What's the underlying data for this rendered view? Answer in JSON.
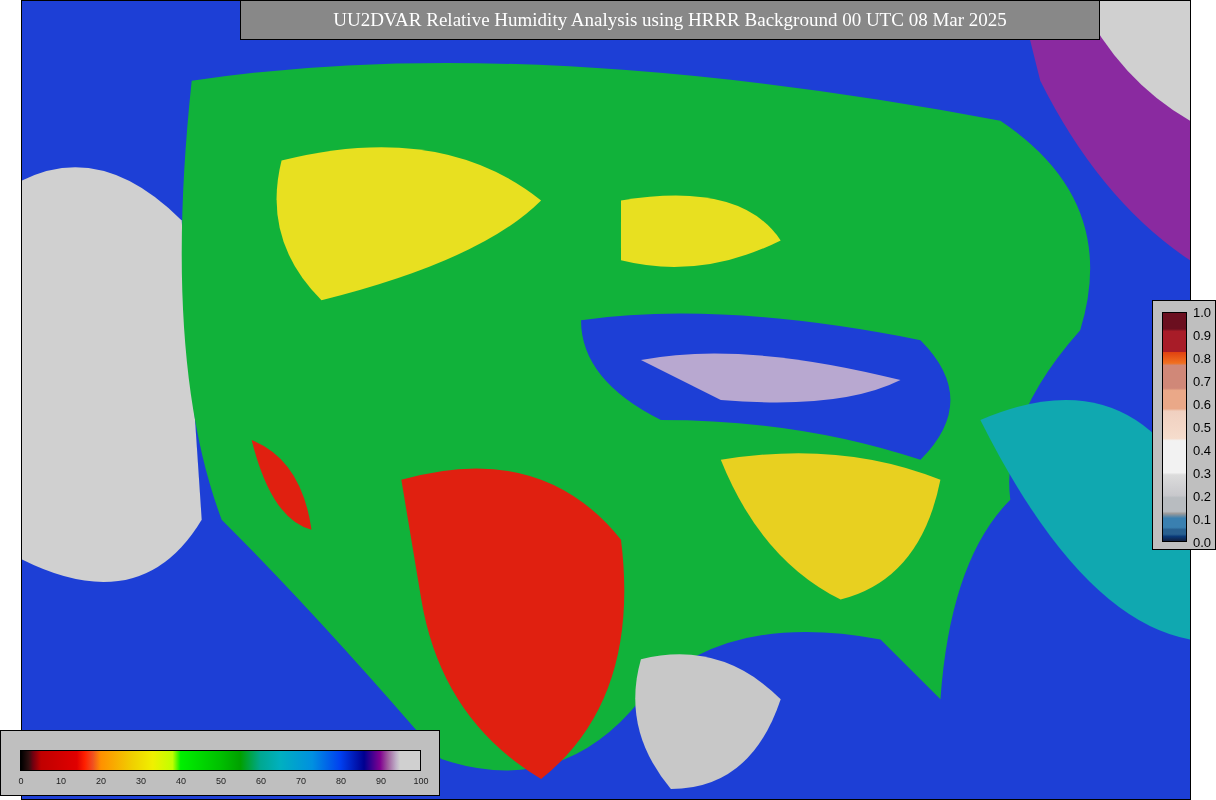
{
  "title": "UU2DVAR Relative Humidity Analysis using HRRR Background 00 UTC 08 Mar 2025",
  "humidity_colorbar": {
    "ticks": [
      "0",
      "10",
      "20",
      "30",
      "40",
      "50",
      "60",
      "70",
      "80",
      "90",
      "100"
    ]
  },
  "observation_colorbar": {
    "ticks": [
      "1.0",
      "0.9",
      "0.8",
      "0.7",
      "0.6",
      "0.5",
      "0.4",
      "0.3",
      "0.2",
      "0.1",
      "0.0"
    ]
  }
}
